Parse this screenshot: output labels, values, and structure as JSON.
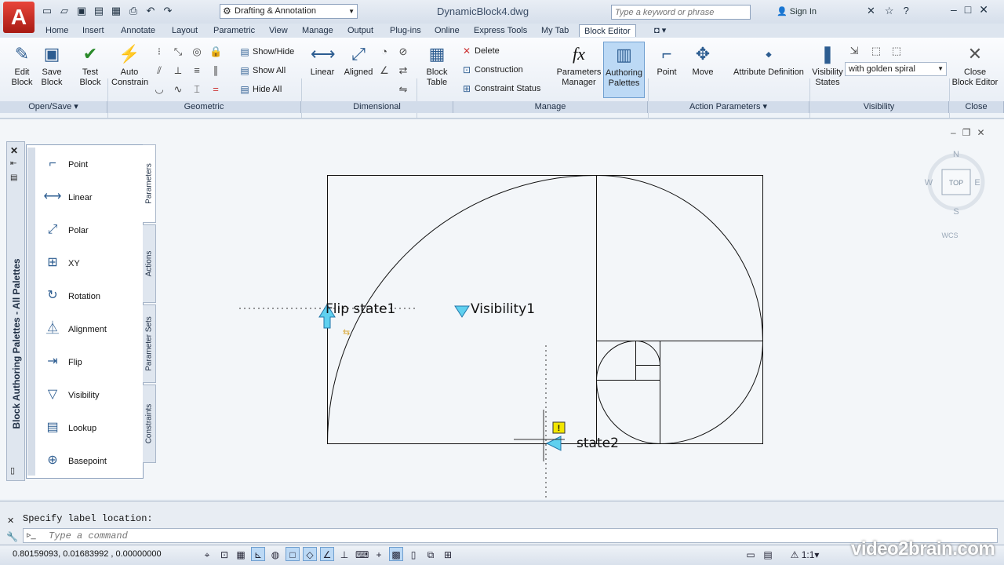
{
  "app": {
    "logo": "A",
    "doc_title": "DynamicBlock4.dwg"
  },
  "workspace": {
    "label": "Drafting & Annotation"
  },
  "search": {
    "placeholder": "Type a keyword or phrase"
  },
  "account": {
    "sign_in": "Sign In"
  },
  "tabs": [
    "Home",
    "Insert",
    "Annotate",
    "Layout",
    "Parametric",
    "View",
    "Manage",
    "Output",
    "Plug-ins",
    "Online",
    "Express Tools",
    "My Tab",
    "Block Editor"
  ],
  "ribbon": {
    "open_save": {
      "label": "Open/Save",
      "edit_block": "Edit\nBlock",
      "save_block": "Save\nBlock"
    },
    "test_block": "Test\nBlock",
    "geometric": {
      "label": "Geometric",
      "auto_constrain": "Auto\nConstrain",
      "show_hide": "Show/Hide",
      "show_all": "Show All",
      "hide_all": "Hide All"
    },
    "dimensional": {
      "label": "Dimensional",
      "linear": "Linear",
      "aligned": "Aligned"
    },
    "manage": {
      "label": "Manage",
      "block_table": "Block\nTable",
      "delete": "Delete",
      "construction": "Construction",
      "constraint_status": "Constraint Status",
      "parameters_manager": "Parameters\nManager",
      "authoring_palettes": "Authoring\nPalettes"
    },
    "action_parameters": {
      "label": "Action Parameters",
      "point": "Point",
      "move": "Move",
      "attribute_definition": "Attribute Definition"
    },
    "visibility": {
      "label": "Visibility",
      "visibility_states": "Visibility\nStates",
      "current_state": "with golden spiral"
    },
    "close": {
      "label": "Close",
      "close_block_editor": "Close\nBlock Editor"
    }
  },
  "palette": {
    "title": "Block Authoring Palettes - All Palettes",
    "items": [
      "Point",
      "Linear",
      "Polar",
      "XY",
      "Rotation",
      "Alignment",
      "Flip",
      "Visibility",
      "Lookup",
      "Basepoint"
    ],
    "tabs": [
      "Parameters",
      "Actions",
      "Parameter Sets",
      "Constraints"
    ]
  },
  "drawing": {
    "flip_label": "Flip state1",
    "visibility_label": "Visibility1",
    "flip_label2": "state2"
  },
  "viewcube": {
    "n": "N",
    "s": "S",
    "e": "E",
    "w": "W",
    "top": "TOP",
    "wcs": "WCS"
  },
  "command": {
    "history": "Specify label location:",
    "placeholder": "Type a command"
  },
  "status": {
    "coords": "0.80159093, 0.01683992 , 0.00000000",
    "scale": "1:1"
  },
  "watermark": "video2brain.com"
}
